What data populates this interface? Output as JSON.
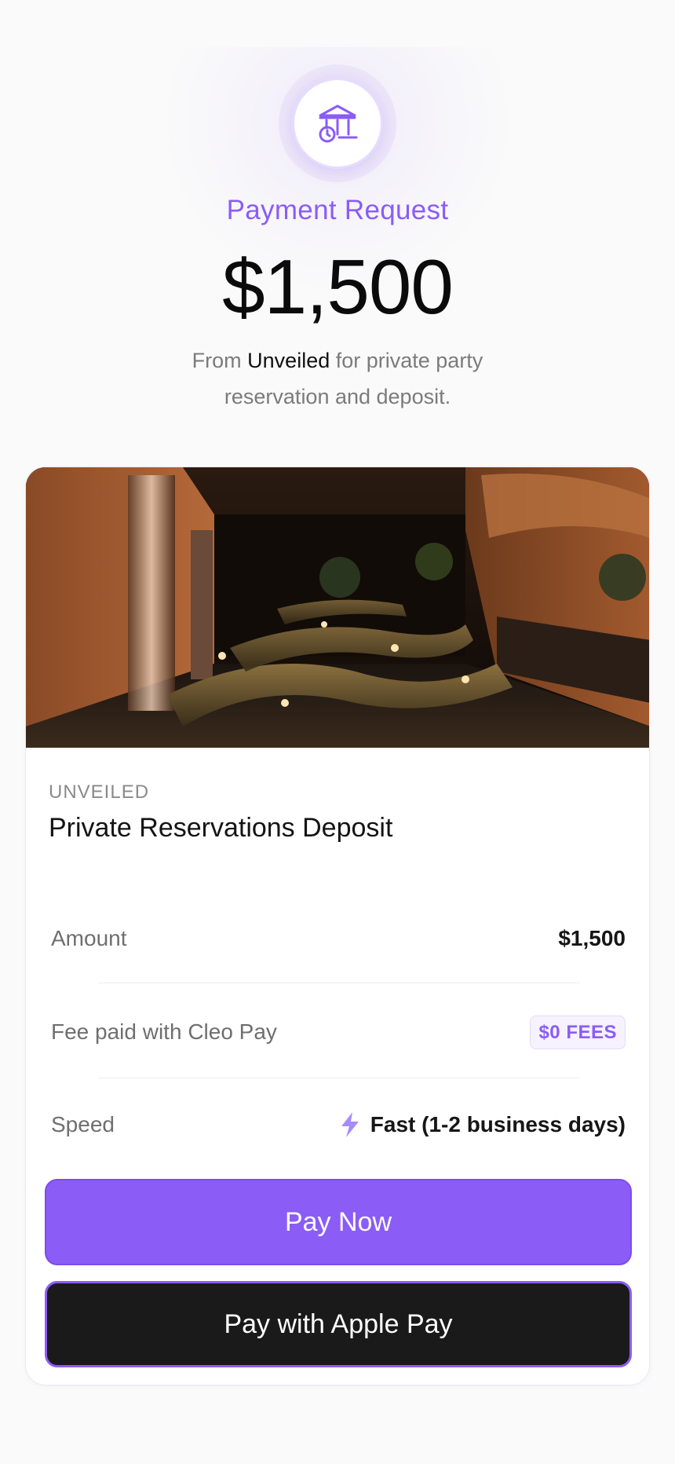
{
  "header": {
    "icon": "bank-clock-icon",
    "label": "Payment Request",
    "amount": "$1,500",
    "desc_prefix": "From ",
    "merchant": "Unveiled",
    "desc_suffix": " for private party reservation and deposit."
  },
  "card": {
    "image_alt": "lounge-photo",
    "eyebrow": "UNVEILED",
    "title": "Private Reservations Deposit",
    "rows": {
      "amount": {
        "label": "Amount",
        "value": "$1,500"
      },
      "fee": {
        "label": "Fee paid with Cleo Pay",
        "badge": "$0 FEES"
      },
      "speed": {
        "label": "Speed",
        "icon": "bolt-icon",
        "value": "Fast (1-2 business days)"
      }
    },
    "buttons": {
      "pay_now": "Pay Now",
      "apple_pay": "Pay with Apple Pay"
    }
  },
  "colors": {
    "accent": "#8b5cf6",
    "dark_button": "#1a1a1a",
    "background": "#fafafa"
  }
}
